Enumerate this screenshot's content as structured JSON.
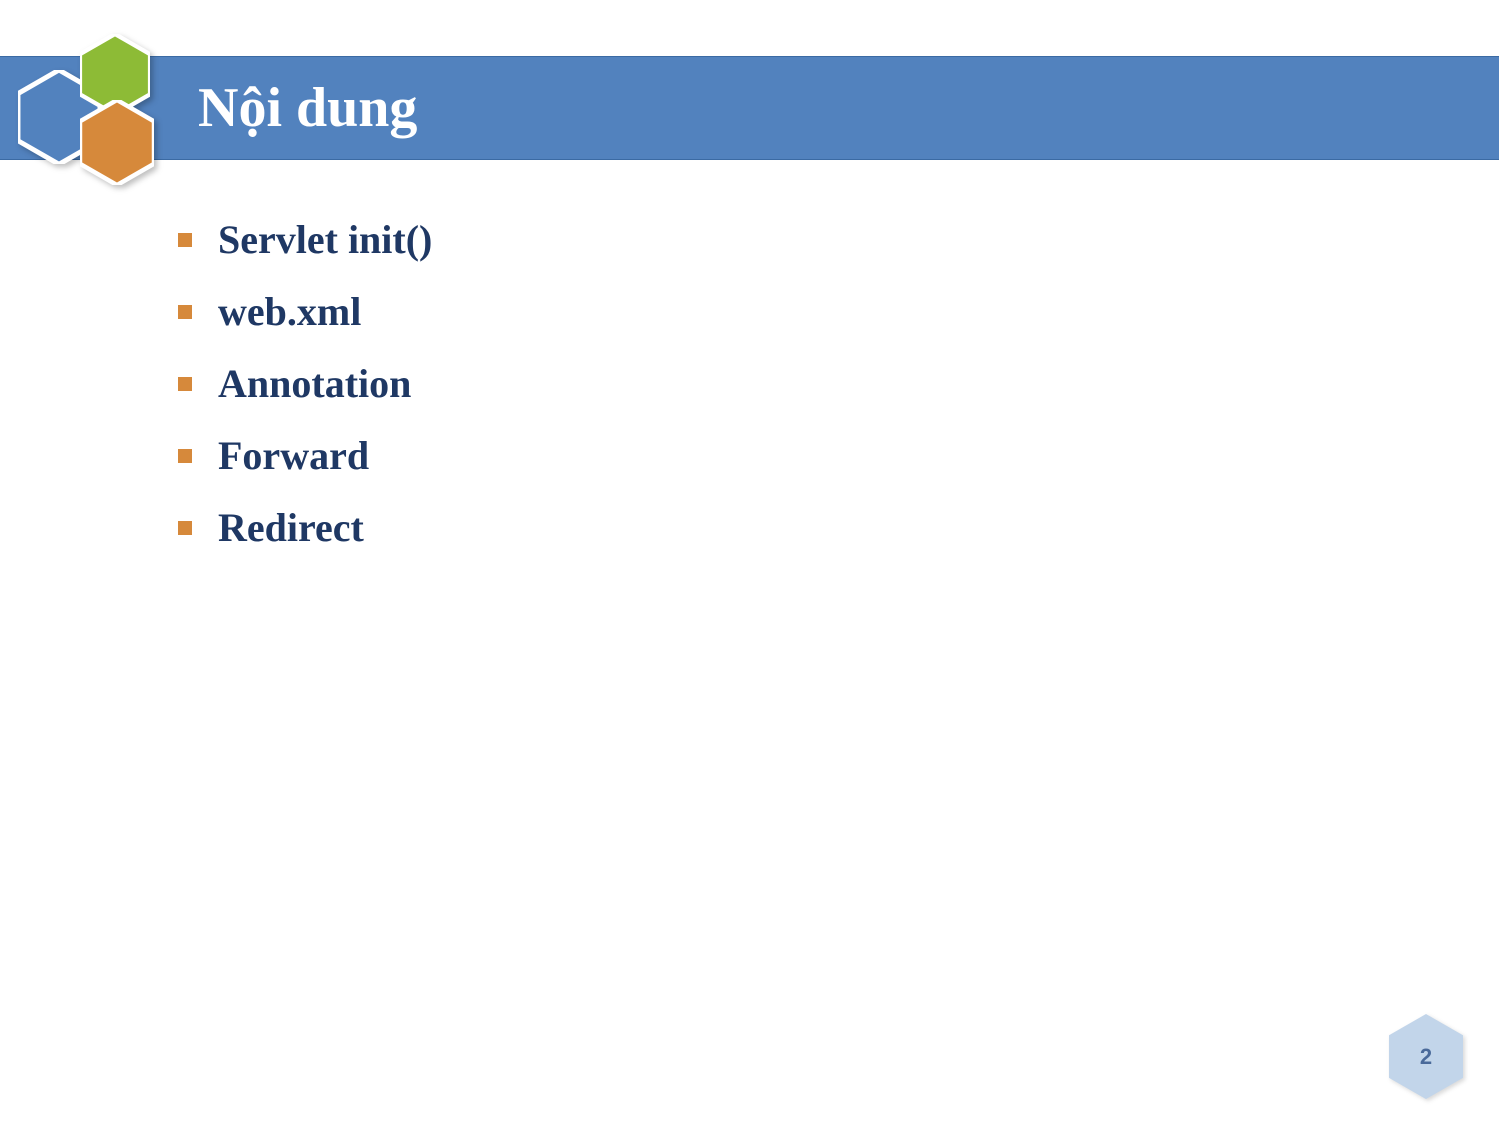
{
  "header": {
    "title": "Nội dung"
  },
  "bullets": [
    "Servlet init()",
    "web.xml",
    "Annotation",
    "Forward",
    "Redirect"
  ],
  "pageNumber": "2",
  "colors": {
    "titleBar": "#5282be",
    "titleText": "#ffffff",
    "bulletMark": "#d6893b",
    "bulletText": "#1f3864",
    "hexBlue": "#5282be",
    "hexGreen": "#8dbb36",
    "hexOrange": "#d6893b",
    "pageHex": "#c2d5ea"
  }
}
